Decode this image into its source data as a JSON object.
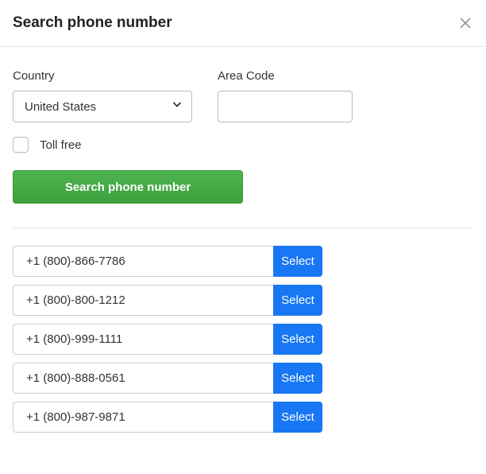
{
  "header": {
    "title": "Search phone number"
  },
  "form": {
    "country_label": "Country",
    "country_value": "United States",
    "area_code_label": "Area Code",
    "area_code_value": "",
    "toll_free_label": "Toll free",
    "search_button": "Search phone number"
  },
  "results": {
    "select_label": "Select",
    "items": [
      {
        "number": "+1 (800)-866-7786"
      },
      {
        "number": "+1 (800)-800-1212"
      },
      {
        "number": "+1 (800)-999-1111"
      },
      {
        "number": "+1 (800)-888-0561"
      },
      {
        "number": "+1 (800)-987-9871"
      }
    ]
  }
}
